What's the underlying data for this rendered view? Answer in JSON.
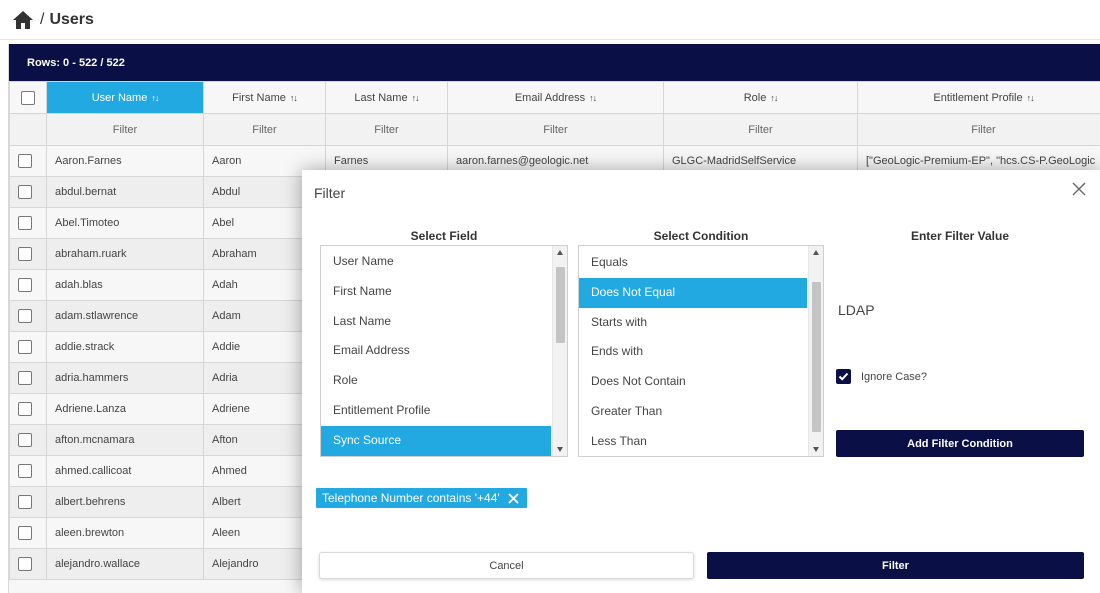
{
  "breadcrumb": {
    "separator": "/",
    "title": "Users"
  },
  "grid": {
    "rows_label": "Rows: 0 - 522 / 522",
    "columns": [
      {
        "label": "User Name",
        "sort_icon": "sort-active-icon",
        "active": true
      },
      {
        "label": "First Name",
        "sort_icon": "sort-icon",
        "active": false
      },
      {
        "label": "Last Name",
        "sort_icon": "sort-icon",
        "active": false
      },
      {
        "label": "Email Address",
        "sort_icon": "sort-icon",
        "active": false
      },
      {
        "label": "Role",
        "sort_icon": "sort-icon",
        "active": false
      },
      {
        "label": "Entitlement Profile",
        "sort_icon": "sort-icon",
        "active": false
      }
    ],
    "filter_label": "Filter",
    "rows": [
      [
        "Aaron.Farnes",
        "Aaron",
        "Farnes",
        "aaron.farnes@geologic.net",
        "GLGC-MadridSelfService",
        "[\"GeoLogic-Premium-EP\", \"hcs.CS-P.GeoLogic"
      ],
      [
        "abdul.bernat",
        "Abdul",
        "",
        "",
        "",
        ""
      ],
      [
        "Abel.Timoteo",
        "Abel",
        "",
        "",
        "",
        ""
      ],
      [
        "abraham.ruark",
        "Abraham",
        "",
        "",
        "",
        ""
      ],
      [
        "adah.blas",
        "Adah",
        "",
        "",
        "",
        ""
      ],
      [
        "adam.stlawrence",
        "Adam",
        "",
        "",
        "",
        ""
      ],
      [
        "addie.strack",
        "Addie",
        "",
        "",
        "",
        ""
      ],
      [
        "adria.hammers",
        "Adria",
        "",
        "",
        "",
        ""
      ],
      [
        "Adriene.Lanza",
        "Adriene",
        "",
        "",
        "",
        ""
      ],
      [
        "afton.mcnamara",
        "Afton",
        "",
        "",
        "",
        ""
      ],
      [
        "ahmed.callicoat",
        "Ahmed",
        "",
        "",
        "",
        ""
      ],
      [
        "albert.behrens",
        "Albert",
        "",
        "",
        "",
        ""
      ],
      [
        "aleen.brewton",
        "Aleen",
        "",
        "",
        "",
        ""
      ],
      [
        "alejandro.wallace",
        "Alejandro",
        "",
        "",
        "",
        ""
      ]
    ]
  },
  "modal": {
    "title": "Filter",
    "select_field_label": "Select Field",
    "select_condition_label": "Select Condition",
    "enter_value_label": "Enter Filter Value",
    "fields": [
      "User Name",
      "First Name",
      "Last Name",
      "Email Address",
      "Role",
      "Entitlement Profile",
      "Sync Source"
    ],
    "selected_field": "Sync Source",
    "conditions": [
      "Equals",
      "Does Not Equal",
      "Starts with",
      "Ends with",
      "Does Not Contain",
      "Greater Than",
      "Less Than"
    ],
    "selected_condition": "Does Not Equal",
    "filter_value": "LDAP",
    "ignore_case_label": "Ignore Case?",
    "ignore_case_checked": true,
    "add_condition_label": "Add Filter Condition",
    "chip_label": "Telephone Number contains '+44'",
    "cancel_label": "Cancel",
    "filter_label": "Filter"
  },
  "colors": {
    "navy": "#0a1045",
    "accent": "#23a9e1"
  }
}
